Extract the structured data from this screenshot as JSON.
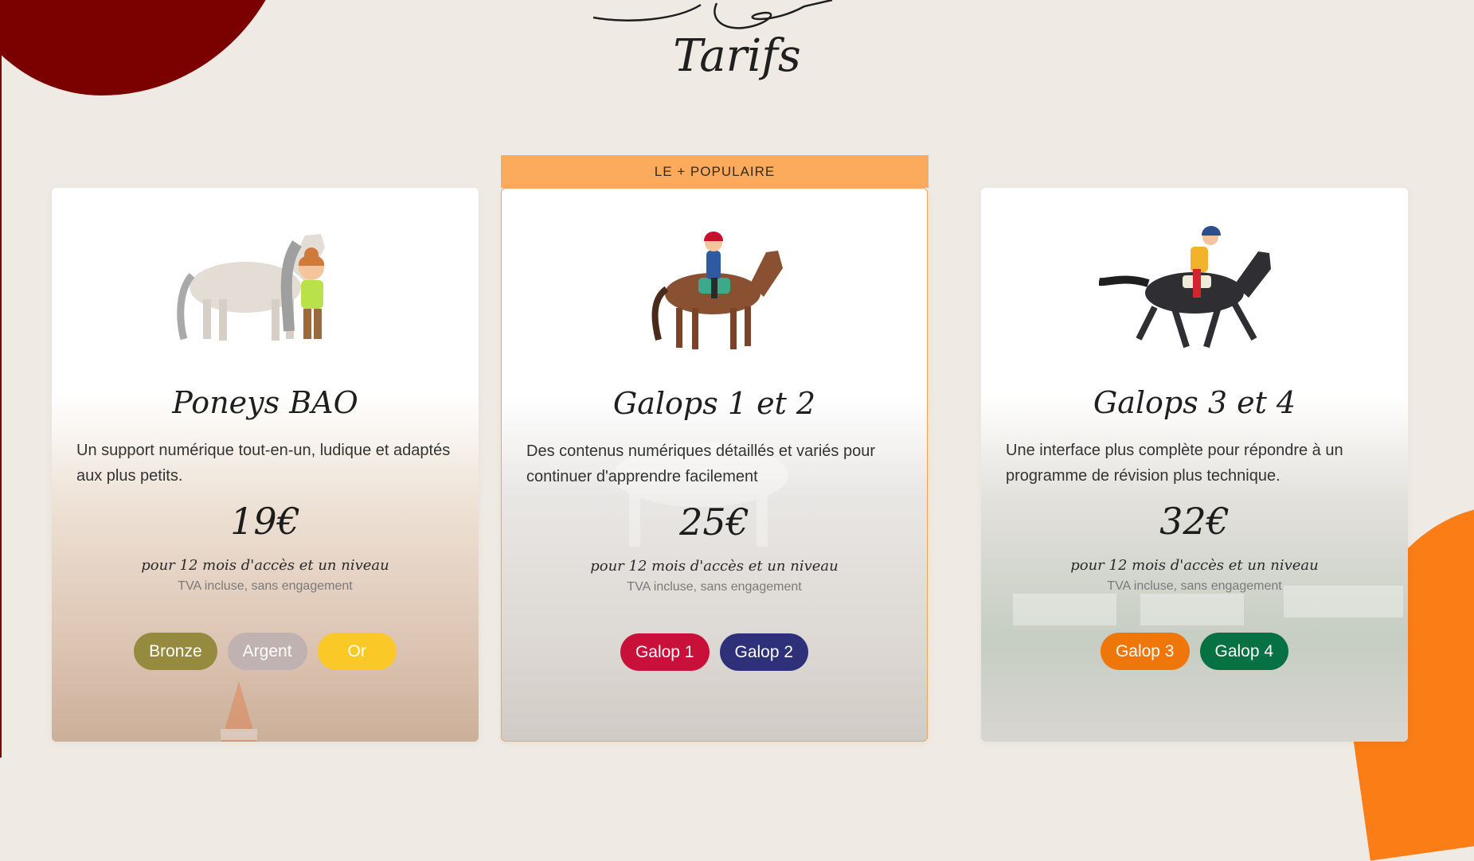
{
  "section": {
    "title": "Tarifs"
  },
  "popular_label": "LE + POPULAIRE",
  "cards": [
    {
      "title": "Poneys BAO",
      "description": "Un support numérique tout-en-un, ludique et adaptés aux plus petits.",
      "price": "19€",
      "price_sub": "pour 12 mois d'accès et un niveau",
      "price_note": "TVA incluse, sans engagement",
      "image": "girl-hugging-pony-illustration",
      "buttons": [
        {
          "label": "Bronze",
          "color": "#958a3e"
        },
        {
          "label": "Argent",
          "color": "#bfb2b0"
        },
        {
          "label": "Or",
          "color": "#fbc927"
        }
      ]
    },
    {
      "title": "Galops 1 et 2",
      "description": "Des contenus numériques détaillés et variés pour continuer d'apprendre facilement",
      "price": "25€",
      "price_sub": "pour 12 mois d'accès et un niveau",
      "price_note": "TVA incluse, sans engagement",
      "image": "girl-riding-horse-illustration",
      "buttons": [
        {
          "label": "Galop 1",
          "color": "#c9103a"
        },
        {
          "label": "Galop 2",
          "color": "#2e3179"
        }
      ]
    },
    {
      "title": "Galops 3 et 4",
      "description": "Une interface plus complète pour répondre à un programme de révision plus technique.",
      "price": "32€",
      "price_sub": "pour 12 mois d'accès et un niveau",
      "price_note": "TVA incluse, sans engagement",
      "image": "jockey-galloping-horse-illustration",
      "buttons": [
        {
          "label": "Galop 3",
          "color": "#ef7608"
        },
        {
          "label": "Galop 4",
          "color": "#067244"
        }
      ]
    }
  ],
  "colors": {
    "background": "#efebe4",
    "accent_dark_red": "#7b0000",
    "accent_orange": "#fb7d16",
    "popular_banner": "#fcaa5c"
  }
}
